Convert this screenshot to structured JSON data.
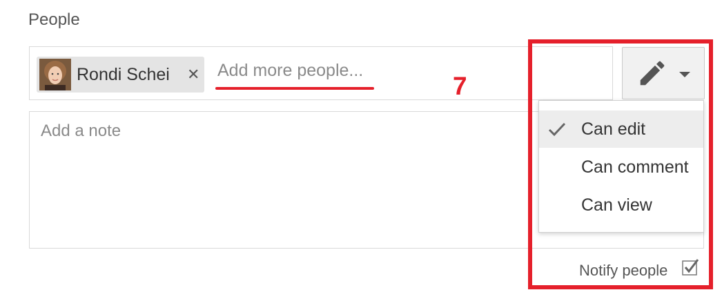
{
  "section": {
    "label": "People"
  },
  "recipient": {
    "name": "Rondi Schei",
    "remove_glyph": "✕"
  },
  "people_input": {
    "placeholder": "Add more people..."
  },
  "annotation": {
    "step": "7",
    "accent_color": "#e5202b"
  },
  "note": {
    "placeholder": "Add a note"
  },
  "permission_button": {
    "icon": "pencil-icon",
    "dropdown_icon": "caret-down-icon"
  },
  "permission_menu": {
    "items": [
      {
        "label": "Can edit",
        "selected": true
      },
      {
        "label": "Can comment",
        "selected": false
      },
      {
        "label": "Can view",
        "selected": false
      }
    ]
  },
  "notify": {
    "label": "Notify people",
    "checked": true
  }
}
